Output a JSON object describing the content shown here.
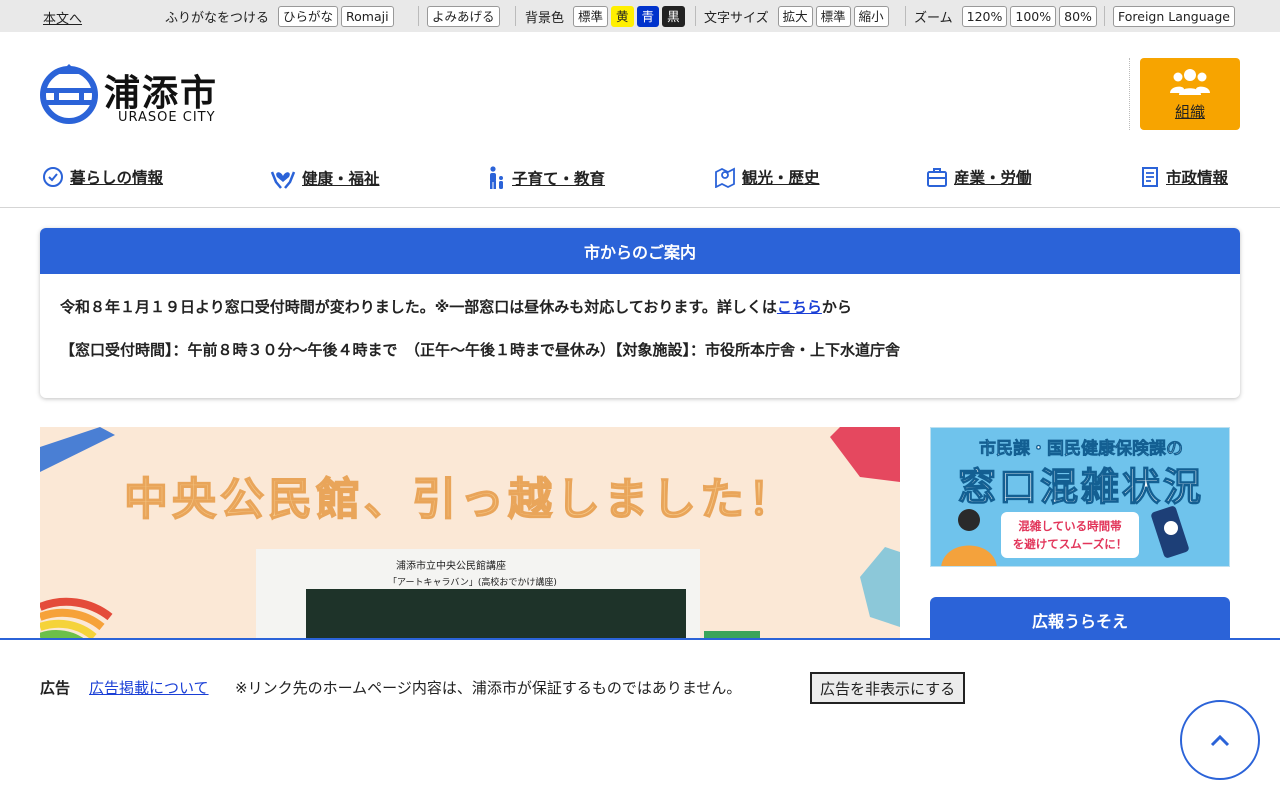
{
  "topbar": {
    "skip_link": "本文へ",
    "furigana_label": "ふりがなをつける",
    "hiragana": "ひらがな",
    "romaji": "Romaji",
    "readaloud": "よみあげる",
    "bg_label": "背景色",
    "bg_standard": "標準",
    "bg_yellow": "黄",
    "bg_blue": "青",
    "bg_black": "黒",
    "textsize_label": "文字サイズ",
    "textsize_up": "拡大",
    "textsize_standard": "標準",
    "textsize_down": "縮小",
    "zoom_label": "ズーム",
    "zoom_120": "120%",
    "zoom_100": "100%",
    "zoom_80": "80%",
    "foreign_language": "Foreign Language"
  },
  "header": {
    "logo_jp": "浦添市",
    "logo_en": "URASOE CITY",
    "org_button": "組織"
  },
  "nav": {
    "items": [
      {
        "label": "暮らしの情報",
        "icon": "clock-check-icon"
      },
      {
        "label": "健康・福祉",
        "icon": "hands-heart-icon"
      },
      {
        "label": "子育て・教育",
        "icon": "parent-child-icon"
      },
      {
        "label": "観光・歴史",
        "icon": "map-pin-icon"
      },
      {
        "label": "産業・労働",
        "icon": "briefcase-icon"
      },
      {
        "label": "市政情報",
        "icon": "document-icon"
      }
    ]
  },
  "notice": {
    "title": "市からのご案内",
    "line1_before": "令和８年１月１９日より窓口受付時間が変わりました。※一部窓口は昼休みも対応しております。詳しくは",
    "line1_link": "こちら",
    "line1_after": "から",
    "line2": "【窓口受付時間】：午前８時３０分〜午後４時まで　（正午〜午後１時まで昼休み）【対象施設】：市役所本庁舎・上下水道庁舎"
  },
  "hero": {
    "title": "中央公民館、引っ越しました！",
    "caption1": "浦添市立中央公民館講座",
    "caption2": "「アートキャラバン」(高校おでかけ講座)"
  },
  "sidebar": {
    "banner_line1": "市民課・国民健康保険課の",
    "banner_line2": "窓口混雑状況",
    "banner_bubble_1": "混雑している時間帯",
    "banner_bubble_2": "を避けてスムーズに！",
    "koho_title": "広報うらそえ"
  },
  "adbar": {
    "label": "広告",
    "link": "広告掲載について",
    "note": "※リンク先のホームページ内容は、浦添市が保証するものではありません。",
    "hide_button": "広告を非表示にする"
  },
  "colors": {
    "primary_blue": "#2b63d8",
    "org_orange": "#f7a400",
    "topbar_gray": "#e9e9e9"
  }
}
